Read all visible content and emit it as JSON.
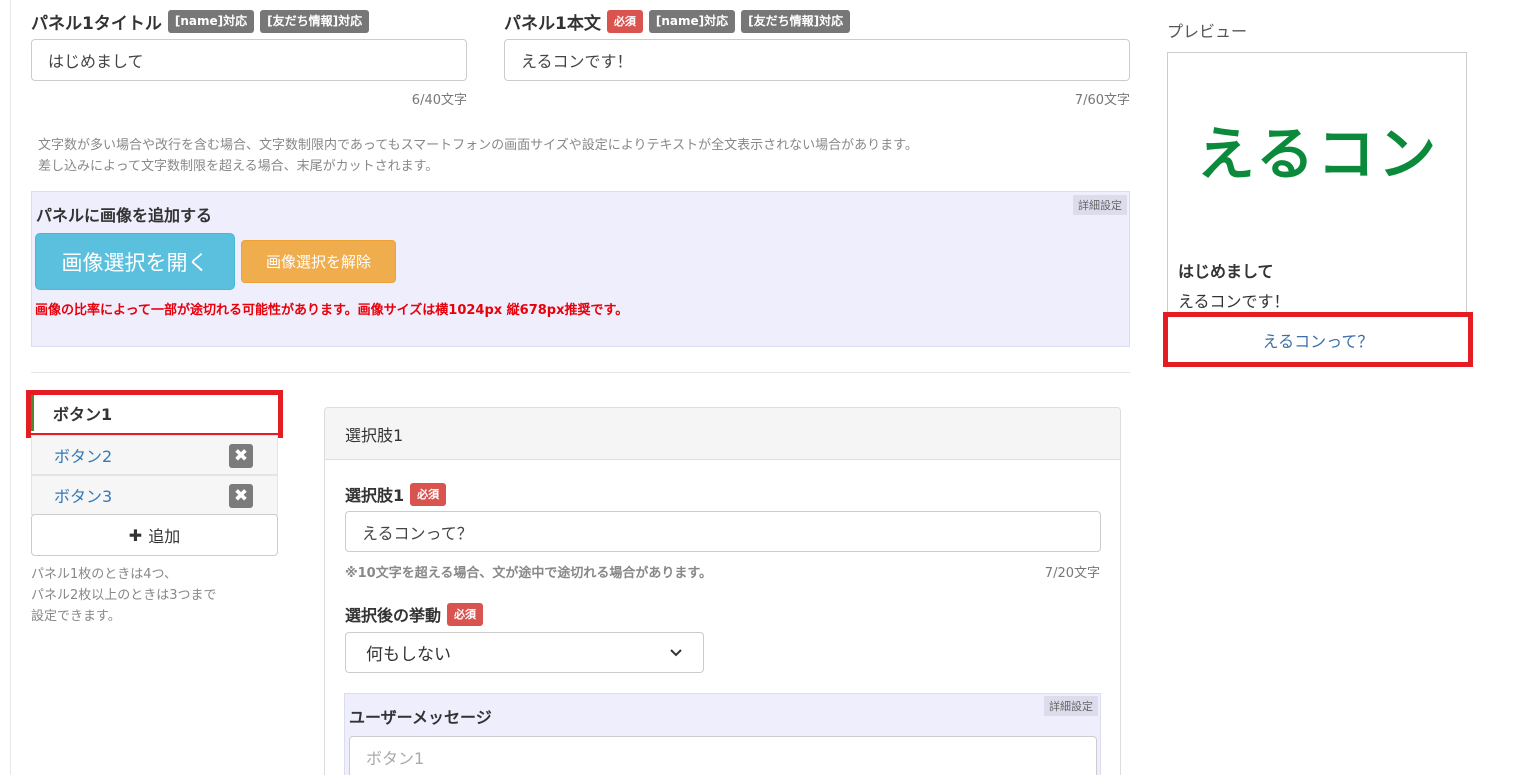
{
  "panel_title": {
    "label": "パネル1タイトル",
    "badges": [
      "[name]対応",
      "[友だち情報]対応"
    ],
    "value": "はじめまして",
    "counter": "6/40文字"
  },
  "panel_body": {
    "label": "パネル1本文",
    "required": "必須",
    "badges": [
      "[name]対応",
      "[友だち情報]対応"
    ],
    "value": "えるコンです！",
    "counter": "7/60文字"
  },
  "notes": [
    "文字数が多い場合や改行を含む場合、文字数制限内であってもスマートフォンの画面サイズや設定によりテキストが全文表示されない場合があります。",
    "差し込みによって文字数制限を超える場合、末尾がカットされます。"
  ],
  "image_section": {
    "advanced_tag": "詳細設定",
    "title": "パネルに画像を追加する",
    "open_button": "画像選択を開く",
    "clear_button": "画像選択を解除",
    "warning": "画像の比率によって一部が途切れる可能性があります。画像サイズは横1024px 縦678px推奨です。"
  },
  "button_tabs": {
    "items": [
      "ボタン1",
      "ボタン2",
      "ボタン3"
    ],
    "active_index": 0,
    "close_glyph": "✖",
    "add_icon": "✚",
    "add_label": "追加",
    "help": [
      "パネル1枚のときは4つ、",
      "パネル2枚以上のときは3つまで",
      "設定できます。"
    ]
  },
  "choice": {
    "header": "選択肢1",
    "field_label": "選択肢1",
    "required": "必須",
    "value": "えるコンって？",
    "hint": "※10文字を超える場合、文が途中で途切れる場合があります。",
    "counter": "7/20文字",
    "action_label": "選択後の挙動",
    "action_required": "必須",
    "action_value": "何もしない",
    "advanced_tag": "詳細設定",
    "user_message_label": "ユーザーメッセージ",
    "user_message_placeholder": "ボタン1"
  },
  "preview": {
    "label": "プレビュー",
    "logo_text": "えるコン",
    "title": "はじめまして",
    "body": "えるコンです！",
    "button": "えるコンって？"
  },
  "colors": {
    "logo_green": "#0a8a3a",
    "highlight_red": "#e41c23",
    "info_button": "#5bc0de",
    "warning_button": "#f0ad4e",
    "image_panel_bg": "#efeefc",
    "required_badge": "#d9534f"
  }
}
